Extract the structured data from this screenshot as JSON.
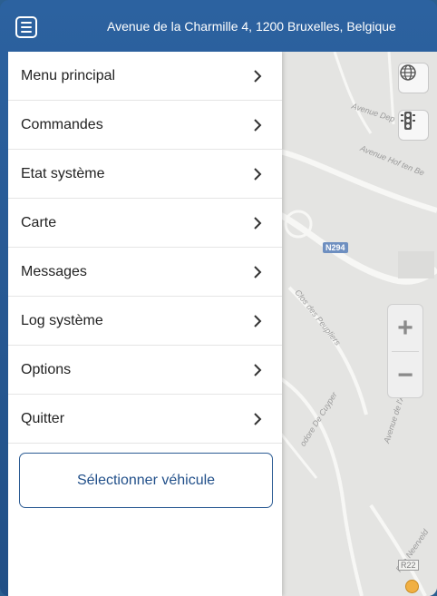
{
  "header": {
    "address": "Avenue de la Charmille 4, 1200 Bruxelles, Belgique"
  },
  "menu": {
    "items": [
      {
        "id": "menu-principal",
        "label": "Menu principal"
      },
      {
        "id": "commandes",
        "label": "Commandes"
      },
      {
        "id": "etat-systeme",
        "label": "Etat système"
      },
      {
        "id": "carte",
        "label": "Carte"
      },
      {
        "id": "messages",
        "label": "Messages"
      },
      {
        "id": "log-systeme",
        "label": "Log système"
      },
      {
        "id": "options",
        "label": "Options"
      },
      {
        "id": "quitter",
        "label": "Quitter"
      }
    ],
    "select_vehicle_label": "Sélectionner véhicule"
  },
  "map": {
    "road_badge_n294": "N294",
    "road_badge_r22": "R22",
    "street_labels": [
      "Avenue Dep",
      "Avenue Hof ten Be",
      "Clos des Peupliers",
      "odore De Cuyper",
      "Avenue de l'A",
      "Rue Neerveld"
    ],
    "zoom_in": "+",
    "zoom_out": "−"
  },
  "colors": {
    "header_bg": "#2c62a0",
    "accent": "#22508a",
    "map_bg": "#e4e4e2"
  },
  "icons": {
    "menu": "hamburger-icon",
    "globe": "globe-icon",
    "traffic": "traffic-light-icon",
    "chevron": "chevron-right-icon"
  }
}
